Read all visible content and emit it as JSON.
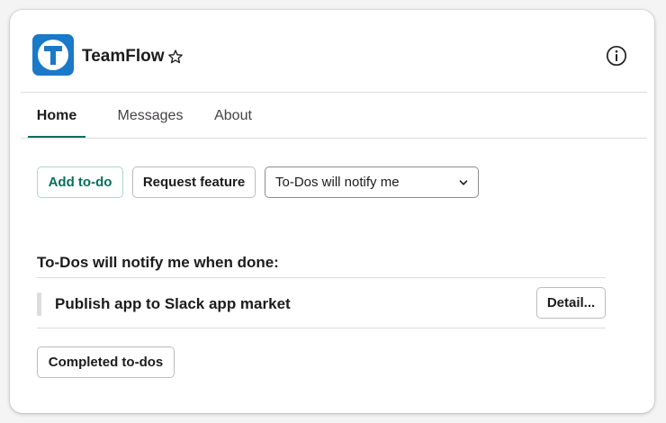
{
  "app": {
    "title": "TeamFlow",
    "icon_letter": "T",
    "brand_color": "#1a79c8",
    "accent_color": "#0b6e5b"
  },
  "icons": {
    "app": "app-logo-icon",
    "favorite": "star-icon",
    "info": "info-icon",
    "dropdown": "chevron-down-icon"
  },
  "tabs": [
    {
      "label": "Home",
      "active": true
    },
    {
      "label": "Messages",
      "active": false
    },
    {
      "label": "About",
      "active": false
    }
  ],
  "actions": {
    "add_todo": "Add to-do",
    "request_feature": "Request feature",
    "notify_select": {
      "selected": "To-Dos will notify me"
    }
  },
  "section": {
    "heading": "To-Dos will notify me when done:",
    "items": [
      {
        "text": "Publish app to Slack app market",
        "action": "Detail..."
      }
    ]
  },
  "footer": {
    "completed_button": "Completed to-dos"
  }
}
